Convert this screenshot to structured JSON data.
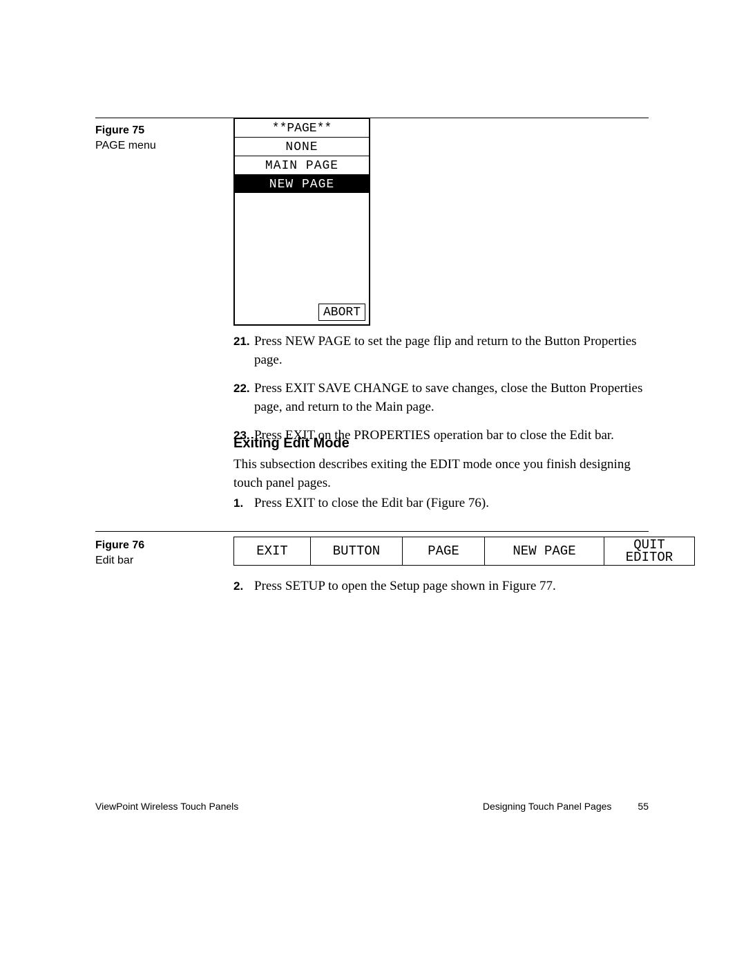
{
  "fig75": {
    "label": "Figure 75",
    "caption": "PAGE menu",
    "menu_title": "**PAGE**",
    "items": [
      "NONE",
      "MAIN PAGE",
      "NEW PAGE"
    ],
    "selected_index": 2,
    "abort": "ABORT"
  },
  "steps_a": [
    {
      "n": "21.",
      "t": "Press NEW PAGE to set the page flip and return to the Button Properties page."
    },
    {
      "n": "22.",
      "t": "Press EXIT SAVE CHANGE to save changes, close the Button Properties page, and return to the Main page."
    },
    {
      "n": "23.",
      "t": "Press EXIT on the PROPERTIES operation bar to close the Edit bar."
    }
  ],
  "section": {
    "heading": "Exiting Edit Mode",
    "intro": "This subsection describes exiting the EDIT mode once you finish designing touch panel pages."
  },
  "steps_b": [
    {
      "n": "1.",
      "t": "Press EXIT to close the Edit bar (Figure 76)."
    }
  ],
  "fig76": {
    "label": "Figure 76",
    "caption": "Edit bar",
    "cells": [
      "EXIT",
      "BUTTON",
      "PAGE",
      "NEW PAGE",
      "QUIT\nEDITOR"
    ]
  },
  "steps_c": [
    {
      "n": "2.",
      "t": "Press SETUP to open the Setup page shown in Figure 77."
    }
  ],
  "footer": {
    "left": "ViewPoint Wireless Touch Panels",
    "right_title": "Designing Touch Panel Pages",
    "right_page": "55"
  }
}
